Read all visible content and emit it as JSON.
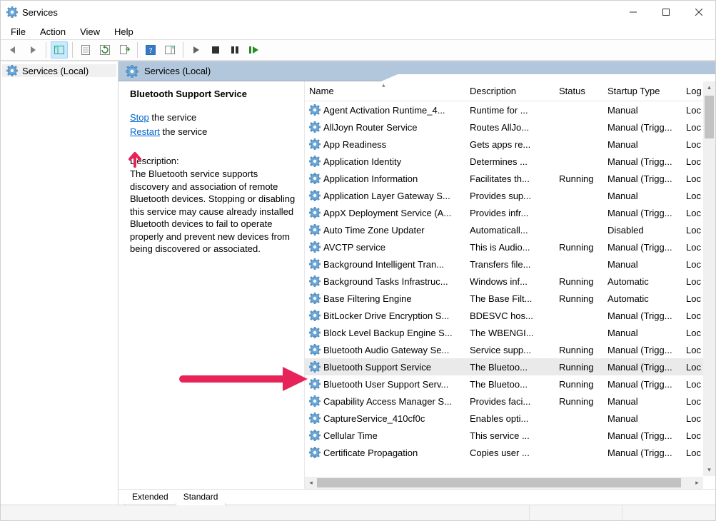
{
  "window": {
    "title": "Services"
  },
  "menu": [
    "File",
    "Action",
    "View",
    "Help"
  ],
  "tree": {
    "root": "Services (Local)"
  },
  "category_header": "Services (Local)",
  "detail": {
    "service_name": "Bluetooth Support Service",
    "stop_link": "Stop",
    "stop_suffix": " the service",
    "restart_link": "Restart",
    "restart_suffix": " the service",
    "desc_label": "Description:",
    "desc_text": "The Bluetooth service supports discovery and association of remote Bluetooth devices.  Stopping or disabling this service may cause already installed Bluetooth devices to fail to operate properly and prevent new devices from being discovered or associated."
  },
  "columns": {
    "name": "Name",
    "desc": "Description",
    "status": "Status",
    "startup": "Startup Type",
    "logon": "Log On As"
  },
  "rows": [
    {
      "name": "Agent Activation Runtime_4...",
      "desc": "Runtime for ...",
      "status": "",
      "startup": "Manual",
      "logon": "Loc"
    },
    {
      "name": "AllJoyn Router Service",
      "desc": "Routes AllJo...",
      "status": "",
      "startup": "Manual (Trigg...",
      "logon": "Loc"
    },
    {
      "name": "App Readiness",
      "desc": "Gets apps re...",
      "status": "",
      "startup": "Manual",
      "logon": "Loc"
    },
    {
      "name": "Application Identity",
      "desc": "Determines ...",
      "status": "",
      "startup": "Manual (Trigg...",
      "logon": "Loc"
    },
    {
      "name": "Application Information",
      "desc": "Facilitates th...",
      "status": "Running",
      "startup": "Manual (Trigg...",
      "logon": "Loc"
    },
    {
      "name": "Application Layer Gateway S...",
      "desc": "Provides sup...",
      "status": "",
      "startup": "Manual",
      "logon": "Loc"
    },
    {
      "name": "AppX Deployment Service (A...",
      "desc": "Provides infr...",
      "status": "",
      "startup": "Manual (Trigg...",
      "logon": "Loc"
    },
    {
      "name": "Auto Time Zone Updater",
      "desc": "Automaticall...",
      "status": "",
      "startup": "Disabled",
      "logon": "Loc"
    },
    {
      "name": "AVCTP service",
      "desc": "This is Audio...",
      "status": "Running",
      "startup": "Manual (Trigg...",
      "logon": "Loc"
    },
    {
      "name": "Background Intelligent Tran...",
      "desc": "Transfers file...",
      "status": "",
      "startup": "Manual",
      "logon": "Loc"
    },
    {
      "name": "Background Tasks Infrastruc...",
      "desc": "Windows inf...",
      "status": "Running",
      "startup": "Automatic",
      "logon": "Loc"
    },
    {
      "name": "Base Filtering Engine",
      "desc": "The Base Filt...",
      "status": "Running",
      "startup": "Automatic",
      "logon": "Loc"
    },
    {
      "name": "BitLocker Drive Encryption S...",
      "desc": "BDESVC hos...",
      "status": "",
      "startup": "Manual (Trigg...",
      "logon": "Loc"
    },
    {
      "name": "Block Level Backup Engine S...",
      "desc": "The WBENGI...",
      "status": "",
      "startup": "Manual",
      "logon": "Loc"
    },
    {
      "name": "Bluetooth Audio Gateway Se...",
      "desc": "Service supp...",
      "status": "Running",
      "startup": "Manual (Trigg...",
      "logon": "Loc"
    },
    {
      "name": "Bluetooth Support Service",
      "desc": "The Bluetoo...",
      "status": "Running",
      "startup": "Manual (Trigg...",
      "logon": "Loc",
      "selected": true
    },
    {
      "name": "Bluetooth User Support Serv...",
      "desc": "The Bluetoo...",
      "status": "Running",
      "startup": "Manual (Trigg...",
      "logon": "Loc"
    },
    {
      "name": "Capability Access Manager S...",
      "desc": "Provides faci...",
      "status": "Running",
      "startup": "Manual",
      "logon": "Loc"
    },
    {
      "name": "CaptureService_410cf0c",
      "desc": "Enables opti...",
      "status": "",
      "startup": "Manual",
      "logon": "Loc"
    },
    {
      "name": "Cellular Time",
      "desc": "This service ...",
      "status": "",
      "startup": "Manual (Trigg...",
      "logon": "Loc"
    },
    {
      "name": "Certificate Propagation",
      "desc": "Copies user ...",
      "status": "",
      "startup": "Manual (Trigg...",
      "logon": "Loc"
    }
  ],
  "tabs": {
    "extended": "Extended",
    "standard": "Standard"
  }
}
